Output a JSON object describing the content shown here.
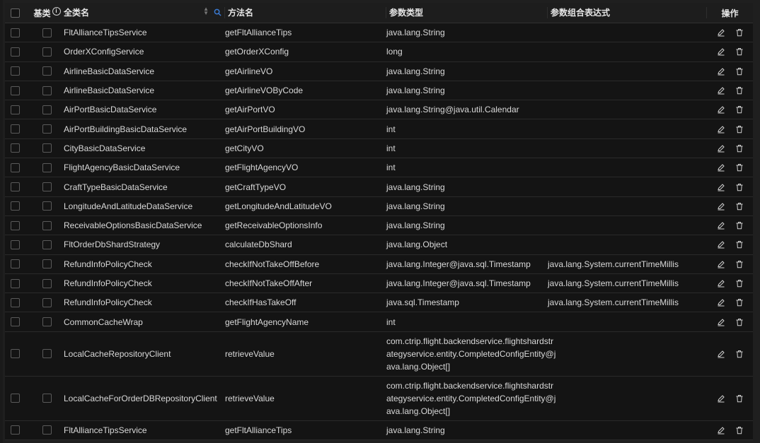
{
  "header": {
    "base_class": "基类",
    "full_name": "全类名",
    "method_name": "方法名",
    "param_type": "参数类型",
    "param_expr": "参数组合表达式",
    "actions": "操作"
  },
  "colors": {
    "background": "#141414",
    "header": "#1d1d1d",
    "search_accent": "#3a7bd5"
  },
  "rows": [
    {
      "class": "FltAllianceTipsService",
      "method": "getFltAllianceTips",
      "param": "java.lang.String",
      "expr": ""
    },
    {
      "class": "OrderXConfigService",
      "method": "getOrderXConfig",
      "param": "long",
      "expr": ""
    },
    {
      "class": "AirlineBasicDataService",
      "method": "getAirlineVO",
      "param": "java.lang.String",
      "expr": ""
    },
    {
      "class": "AirlineBasicDataService",
      "method": "getAirlineVOByCode",
      "param": "java.lang.String",
      "expr": ""
    },
    {
      "class": "AirPortBasicDataService",
      "method": "getAirPortVO",
      "param": "java.lang.String@java.util.Calendar",
      "expr": ""
    },
    {
      "class": "AirPortBuildingBasicDataService",
      "method": "getAirPortBuildingVO",
      "param": "int",
      "expr": ""
    },
    {
      "class": "CityBasicDataService",
      "method": "getCityVO",
      "param": "int",
      "expr": ""
    },
    {
      "class": "FlightAgencyBasicDataService",
      "method": "getFlightAgencyVO",
      "param": "int",
      "expr": ""
    },
    {
      "class": "CraftTypeBasicDataService",
      "method": "getCraftTypeVO",
      "param": "java.lang.String",
      "expr": ""
    },
    {
      "class": "LongitudeAndLatitudeDataService",
      "method": "getLongitudeAndLatitudeVO",
      "param": "java.lang.String",
      "expr": ""
    },
    {
      "class": "ReceivableOptionsBasicDataService",
      "method": "getReceivableOptionsInfo",
      "param": "java.lang.String",
      "expr": ""
    },
    {
      "class": "FltOrderDbShardStrategy",
      "method": "calculateDbShard",
      "param": "java.lang.Object",
      "expr": ""
    },
    {
      "class": "RefundInfoPolicyCheck",
      "method": "checkIfNotTakeOffBefore",
      "param": "java.lang.Integer@java.sql.Timestamp",
      "expr": "java.lang.System.currentTimeMillis"
    },
    {
      "class": "RefundInfoPolicyCheck",
      "method": "checkIfNotTakeOffAfter",
      "param": "java.lang.Integer@java.sql.Timestamp",
      "expr": "java.lang.System.currentTimeMillis"
    },
    {
      "class": "RefundInfoPolicyCheck",
      "method": "checkIfHasTakeOff",
      "param": "java.sql.Timestamp",
      "expr": "java.lang.System.currentTimeMillis"
    },
    {
      "class": "CommonCacheWrap",
      "method": "getFlightAgencyName",
      "param": "int",
      "expr": ""
    },
    {
      "class": "LocalCacheRepositoryClient",
      "method": "retrieveValue",
      "param": "com.ctrip.flight.backendservice.flightshardstrategyservice.entity.CompletedConfigEntity@java.lang.Object[]",
      "param_lines": [
        "com.ctrip.flight.backendservice.flightshardstr",
        "ategyservice.entity.CompletedConfigEntity@j",
        "ava.lang.Object[]"
      ],
      "expr": ""
    },
    {
      "class": "LocalCacheForOrderDBRepositoryClient",
      "method": "retrieveValue",
      "param": "com.ctrip.flight.backendservice.flightshardstrategyservice.entity.CompletedConfigEntity@java.lang.Object[]",
      "param_lines": [
        "com.ctrip.flight.backendservice.flightshardstr",
        "ategyservice.entity.CompletedConfigEntity@j",
        "ava.lang.Object[]"
      ],
      "expr": ""
    },
    {
      "class": "FltAllianceTipsService",
      "method": "getFltAllianceTips",
      "param": "java.lang.String",
      "expr": ""
    }
  ]
}
